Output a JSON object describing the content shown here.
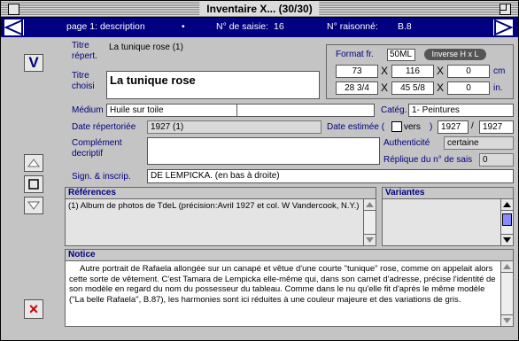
{
  "window": {
    "title": "Inventaire X... (30/30)"
  },
  "nav": {
    "page": "page 1: description",
    "dot": "•",
    "saisie_label": "N° de saisie:",
    "saisie_value": "16",
    "raisonne_label": "N° raisonné:",
    "raisonne_value": "B.8"
  },
  "titre_repert": {
    "label1": "Titre",
    "label2": "répert.",
    "value": "La tunique rose (1)"
  },
  "titre_choisi": {
    "label1": "Titre",
    "label2": "choisi",
    "value": "La tunique rose"
  },
  "format": {
    "label": "Format fr.",
    "value": "50ML",
    "button": "Inverse H x L",
    "row1": [
      "73",
      "116",
      "0"
    ],
    "row1_unit": "cm",
    "row2": [
      "28 3/4",
      "45 5/8",
      "0"
    ],
    "row2_unit": "in.",
    "x": "X"
  },
  "medium": {
    "label": "Médium",
    "value": "Huile sur toile",
    "value2": ""
  },
  "categ": {
    "label": "Catég.",
    "value": "1- Peintures"
  },
  "date_rep": {
    "label": "Date répertoriée",
    "value": "1927 (1)"
  },
  "date_est": {
    "label": "Date estimée (",
    "vers": "vers",
    "paren": ")",
    "from": "1927",
    "slash": "/",
    "to": "1927"
  },
  "complement": {
    "label1": "Complément",
    "label2": "decriptif",
    "value": ""
  },
  "authenticite": {
    "label": "Authenticité",
    "value": "certaine"
  },
  "replique": {
    "label": "Réplique du n° de sais",
    "value": "0"
  },
  "sign": {
    "label": "Sign. & inscrip.",
    "value": "DE LEMPICKA. (en bas à droite)"
  },
  "references": {
    "title": "Références",
    "text": "(1) Album de photos de TdeL (précision:Avril 1927 et col. W Vandercook, N.Y.)"
  },
  "variantes": {
    "title": "Variantes",
    "text": ""
  },
  "notice": {
    "title": "Notice",
    "text": "Autre portrait de Rafaela allongée sur un canapé et vêtue d'une courte \"tunique\" rose, comme on appelait alors cette sorte de vêtement. C'est Tamara de Lempicka elle-même qui, dans son carnet d'adresse, précise l'identité de son modèle en regard du nom du possesseur du tableau. Comme dans le nu qu'elle fit d'après le même modèle (\"La belle Rafaela\", B.87), les harmonies sont ici réduites à une couleur majeure et des variations de gris."
  },
  "buttons": {
    "v": "V",
    "x_label": "×"
  },
  "colors": {
    "nav": "#000080",
    "label": "#000080",
    "delete": "#cc0000"
  }
}
